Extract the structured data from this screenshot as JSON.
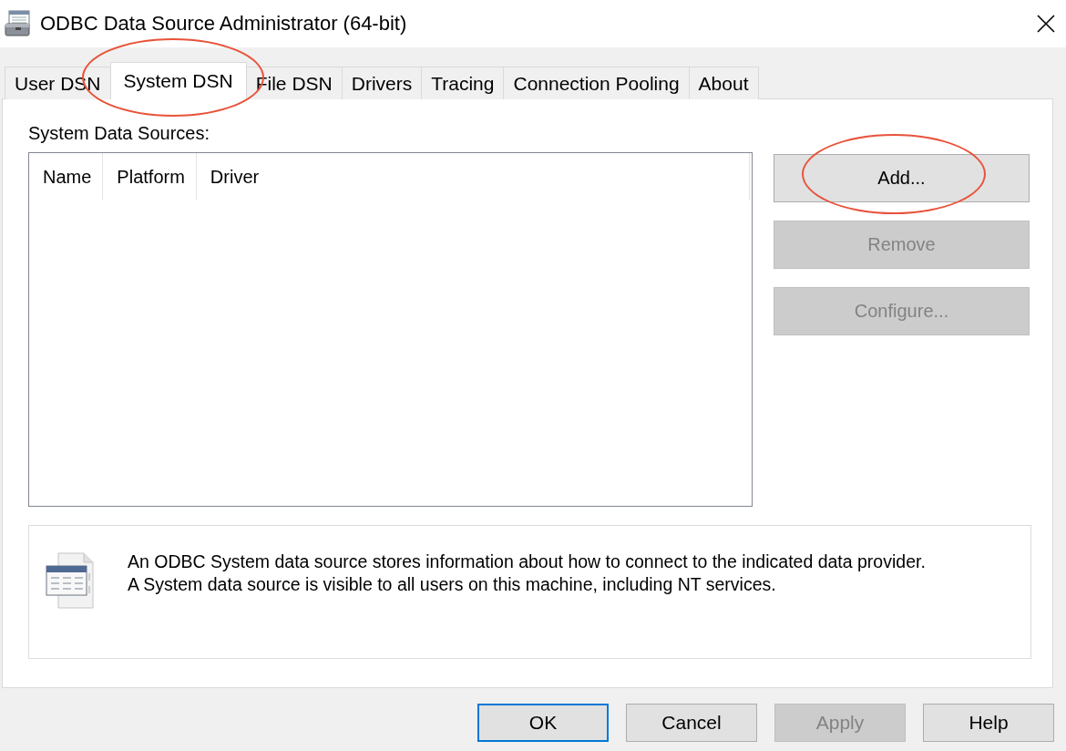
{
  "window": {
    "title": "ODBC Data Source Administrator (64-bit)"
  },
  "tabs": [
    {
      "label": "User DSN",
      "selected": false,
      "circled": false
    },
    {
      "label": "System DSN",
      "selected": true,
      "circled": true
    },
    {
      "label": "File DSN",
      "selected": false,
      "circled": false
    },
    {
      "label": "Drivers",
      "selected": false,
      "circled": false
    },
    {
      "label": "Tracing",
      "selected": false,
      "circled": false
    },
    {
      "label": "Connection Pooling",
      "selected": false,
      "circled": false
    },
    {
      "label": "About",
      "selected": false,
      "circled": false
    }
  ],
  "panel": {
    "label": "System Data Sources:",
    "columns": [
      "Name",
      "Platform",
      "Driver"
    ],
    "actions": [
      {
        "label": "Add...",
        "disabled": false,
        "circled": true
      },
      {
        "label": "Remove",
        "disabled": true,
        "circled": false
      },
      {
        "label": "Configure...",
        "disabled": true,
        "circled": false
      }
    ],
    "info": [
      "An ODBC System data source stores information about how to connect to the indicated data provider.",
      "A System data source is visible to all users on this machine, including NT services."
    ]
  },
  "buttons": [
    {
      "label": "OK",
      "default": true,
      "disabled": false
    },
    {
      "label": "Cancel",
      "default": false,
      "disabled": false
    },
    {
      "label": "Apply",
      "default": false,
      "disabled": true
    },
    {
      "label": "Help",
      "default": false,
      "disabled": false
    }
  ]
}
